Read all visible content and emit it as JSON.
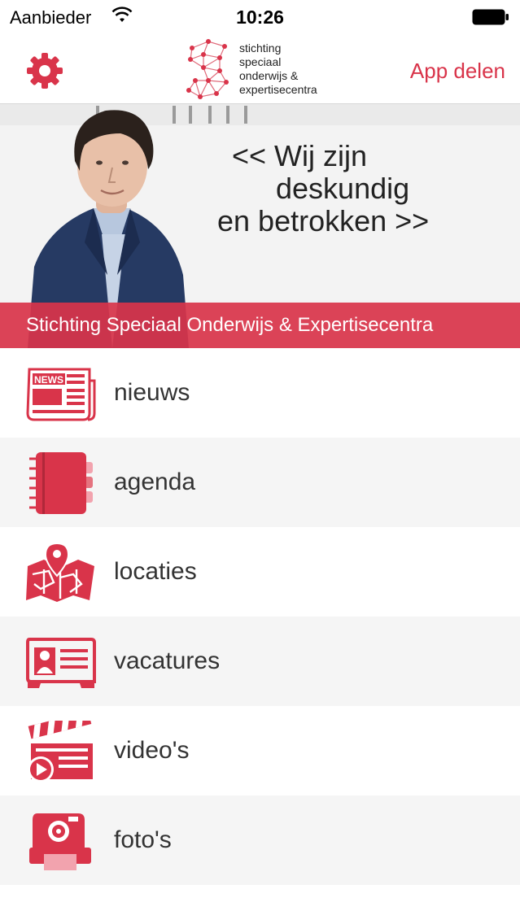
{
  "status_bar": {
    "carrier": "Aanbieder",
    "time": "10:26"
  },
  "nav": {
    "logo_lines": [
      "stichting",
      "speciaal",
      "onderwijs &",
      "expertisecentra"
    ],
    "share_label": "App delen"
  },
  "banner": {
    "quote_lines": [
      "<< Wij zijn",
      "deskundig",
      "en betrokken >>"
    ],
    "caption": "Stichting Speciaal Onderwijs & Expertisecentra"
  },
  "menu": {
    "items": [
      {
        "label": "nieuws",
        "icon": "newspaper-icon"
      },
      {
        "label": "agenda",
        "icon": "notebook-icon"
      },
      {
        "label": "locaties",
        "icon": "map-pin-icon"
      },
      {
        "label": "vacatures",
        "icon": "id-card-icon"
      },
      {
        "label": "video's",
        "icon": "clapperboard-icon"
      },
      {
        "label": "foto's",
        "icon": "instant-camera-icon"
      }
    ]
  },
  "colors": {
    "accent": "#d9344a",
    "text": "#333333"
  }
}
